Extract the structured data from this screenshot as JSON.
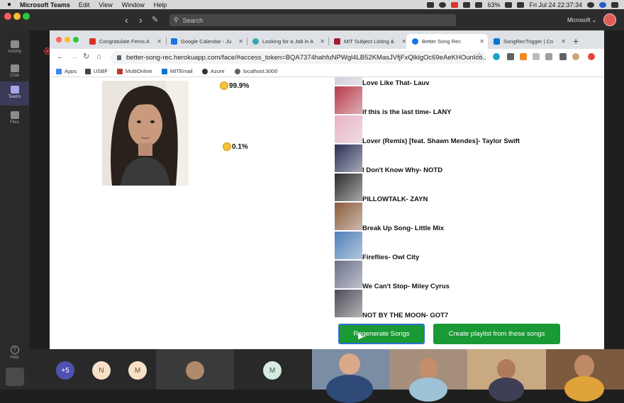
{
  "menubar": {
    "app": "Microsoft Teams",
    "menus": [
      "Edit",
      "View",
      "Window",
      "Help"
    ],
    "battery": "63%",
    "datetime": "Fri Jul 24  22:37:34"
  },
  "teams": {
    "search_placeholder": "Search",
    "org_label": "Microsoft",
    "rail": [
      {
        "label": "Activity",
        "icon": "bell-icon"
      },
      {
        "label": "Chat",
        "icon": "chat-icon"
      },
      {
        "label": "Teams",
        "icon": "teams-icon"
      },
      {
        "label": "Files",
        "icon": "files-icon"
      }
    ],
    "help_label": "Help"
  },
  "browser": {
    "tabs": [
      {
        "title": "Congratulate Ferris A",
        "color": "#d93025"
      },
      {
        "title": "Google Calendar - Ju",
        "color": "#1a73e8"
      },
      {
        "title": "Looking for a Job in A",
        "color": "#34a7b6"
      },
      {
        "title": "MIT Subject Listing &",
        "color": "#a31f34"
      },
      {
        "title": "Better Song Rec",
        "color": "#1a73e8"
      },
      {
        "title": "SongRecTrigger | Co",
        "color": "#0078d4"
      }
    ],
    "url": "better-song-rec.herokuapp.com/face/#access_token=BQA7374hahfuNPWgl4LB52KMasJVfjFxQlklgOc69eAeKHOunIco...",
    "bookmarks": [
      {
        "label": "Apps",
        "color": "#4285f4"
      },
      {
        "label": "USBF",
        "color": "#444444"
      },
      {
        "label": "MultiOnline",
        "color": "#c0392b"
      },
      {
        "label": "MITEmail",
        "color": "#0078d4"
      },
      {
        "label": "Azure",
        "color": "#333333"
      },
      {
        "label": "localhost:3000",
        "color": "#5f6368"
      }
    ]
  },
  "app": {
    "emotions": [
      {
        "label": "99.9%",
        "icon": "neutral-face-icon"
      },
      {
        "label": "0.1%",
        "icon": "sad-face-icon"
      }
    ],
    "songs": [
      {
        "title": "Love Like That- Lauv",
        "color": "#c7c7d4"
      },
      {
        "title": "if this is the last time- LANY",
        "color": "#b83a4b"
      },
      {
        "title": "Lover (Remix) [feat. Shawn Mendes]- Taylor Swift",
        "color": "#e7b3c7"
      },
      {
        "title": "I Don't Know Why- NOTD",
        "color": "#2a2f55"
      },
      {
        "title": "PILLOWTALK- ZAYN",
        "color": "#2b2b2b"
      },
      {
        "title": "Break Up Song- Little Mix",
        "color": "#8a5b3b"
      },
      {
        "title": "Fireflies- Owl City",
        "color": "#4d7fb8"
      },
      {
        "title": "We Can't Stop- Miley Cyrus",
        "color": "#6a6f8a"
      },
      {
        "title": "NOT BY THE MOON- GOT7",
        "color": "#4b4b55"
      }
    ],
    "regenerate_label": "Regenerate Songs",
    "create_playlist_label": "Create playlist from these songs"
  },
  "meeting": {
    "overflow_count": "+5",
    "initials": [
      "N",
      "M",
      "M"
    ]
  }
}
